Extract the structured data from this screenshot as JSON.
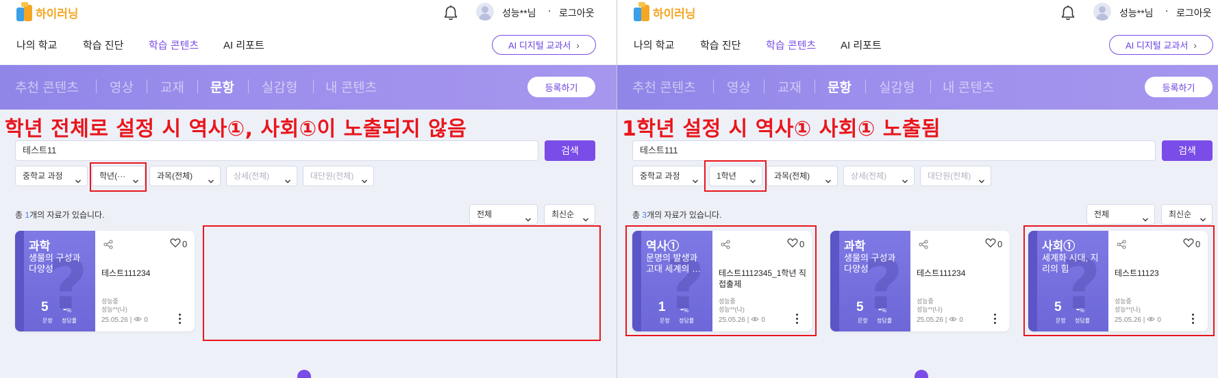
{
  "panels": [
    {
      "logo_text": "하이러닝",
      "user_name": "성능**님",
      "separator": "·",
      "logout": "로그아웃",
      "nav": [
        "나의 학교",
        "학습 진단",
        "학습 콘텐츠",
        "AI 리포트"
      ],
      "nav_active_index": 2,
      "ai_button": "AI 디지털 교과서",
      "tabs": [
        "추천 콘텐츠",
        "영상",
        "교재",
        "문항",
        "실감형",
        "내 콘텐츠"
      ],
      "tab_active_index": 3,
      "register_button": "등록하기",
      "annotation": "학년 전체로 설정 시 역사①, 사회①이 노출되지 않음",
      "search_value": "테스트11",
      "search_button": "검색",
      "filters": [
        "중학교 과정",
        "학년(···",
        "과목(전체)",
        "상세(전체)",
        "대단원(전체)"
      ],
      "count_prefix": "총 ",
      "count": "1",
      "count_suffix": "개의 자료가 있습니다.",
      "sort_scope": "전체",
      "sort_order": "최신순",
      "cards": [
        {
          "subject": "과학",
          "title": "생물의 구성과 다양성",
          "items": "5",
          "rate": "-",
          "rate_unit": "%",
          "items_label": "문항",
          "rate_label": "정답률",
          "name": "테스트111234",
          "school": "성능중",
          "author": "성능**(나)",
          "date": "25.05.26 |",
          "views": "0",
          "likes": "0"
        }
      ]
    },
    {
      "logo_text": "하이러닝",
      "user_name": "성능**님",
      "separator": "·",
      "logout": "로그아웃",
      "nav": [
        "나의 학교",
        "학습 진단",
        "학습 콘텐츠",
        "AI 리포트"
      ],
      "nav_active_index": 2,
      "ai_button": "AI 디지털 교과서",
      "tabs": [
        "추천 콘텐츠",
        "영상",
        "교재",
        "문항",
        "실감형",
        "내 콘텐츠"
      ],
      "tab_active_index": 3,
      "register_button": "등록하기",
      "annotation": "1학년 설정 시 역사① 사회① 노출됨",
      "search_value": "테스트111",
      "search_button": "검색",
      "filters": [
        "중학교 과정",
        "1학년",
        "과목(전체)",
        "상세(전체)",
        "대단원(전체)"
      ],
      "count_prefix": "총 ",
      "count": "3",
      "count_suffix": "개의 자료가 있습니다.",
      "sort_scope": "전체",
      "sort_order": "최신순",
      "cards": [
        {
          "subject": "역사①",
          "title": "문명의 발생과 고대 세계의 …",
          "items": "1",
          "rate": "-",
          "rate_unit": "%",
          "items_label": "문항",
          "rate_label": "정답률",
          "name": "테스트1112345_1학년 직접출제",
          "school": "성능중",
          "author": "성능**(나)",
          "date": "25.05.26 |",
          "views": "0",
          "likes": "0"
        },
        {
          "subject": "과학",
          "title": "생물의 구성과 다양성",
          "items": "5",
          "rate": "-",
          "rate_unit": "%",
          "items_label": "문항",
          "rate_label": "정답률",
          "name": "테스트111234",
          "school": "성능중",
          "author": "성능**(나)",
          "date": "25.05.26 |",
          "views": "0",
          "likes": "0"
        },
        {
          "subject": "사회①",
          "title": "세계화 시대, 지리의 힘",
          "items": "5",
          "rate": "-",
          "rate_unit": "%",
          "items_label": "문항",
          "rate_label": "정답률",
          "name": "테스트11123",
          "school": "성능중",
          "author": "성능**(나)",
          "date": "25.05.26 |",
          "views": "0",
          "likes": "0"
        }
      ]
    }
  ],
  "colors": {
    "accent": "#7a4ce8",
    "category_bar": "#9c8eec",
    "card_cover": "#7e79e4",
    "annotation": "#e8161c",
    "count_number": "#4a7be8"
  }
}
